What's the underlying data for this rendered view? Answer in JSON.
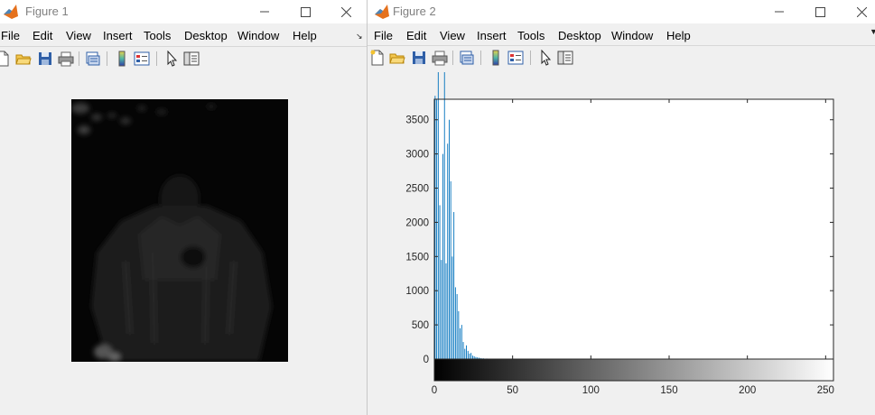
{
  "figure1": {
    "title": "Figure 1",
    "menu": [
      "File",
      "Edit",
      "View",
      "Insert",
      "Tools",
      "Desktop",
      "Window",
      "Help"
    ],
    "image": {
      "description_icon": "grayscale-dark-photo"
    }
  },
  "figure2": {
    "title": "Figure 2",
    "menu": [
      "File",
      "Edit",
      "View",
      "Insert",
      "Tools",
      "Desktop",
      "Window",
      "Help"
    ]
  },
  "window_controls": [
    "minimize-icon",
    "maximize-icon",
    "close-icon"
  ],
  "toolbar_icons": [
    "new-figure-icon",
    "open-file-icon",
    "save-icon",
    "print-icon",
    "print-preview-icon",
    "insert-colorbar-icon",
    "insert-legend-icon",
    "select-arrow-icon",
    "property-inspector-icon"
  ],
  "colors": {
    "bar": "#0072bd",
    "axis": "#262626",
    "matlab_orange": "#e5711d"
  },
  "chart_data": {
    "type": "bar",
    "title": "",
    "xlabel": "",
    "ylabel": "",
    "xlim": [
      0,
      255
    ],
    "ylim": [
      0,
      3800
    ],
    "x_ticks": [
      0,
      50,
      100,
      150,
      200,
      250
    ],
    "y_ticks": [
      0,
      500,
      1000,
      1500,
      2000,
      2500,
      3000,
      3500
    ],
    "colorbar": "grayscale 0-255",
    "series": [
      {
        "x": [
          0,
          1,
          2,
          3,
          4,
          5,
          6,
          7,
          8,
          9,
          10,
          11,
          12,
          13,
          14,
          15,
          16,
          17,
          18,
          19,
          20,
          21,
          22,
          23,
          24,
          25,
          26,
          27,
          28,
          29,
          30,
          31,
          33,
          35,
          38,
          42,
          46
        ],
        "values": [
          3850,
          3800,
          4200,
          2250,
          1450,
          3000,
          4200,
          1400,
          3150,
          3500,
          2600,
          1500,
          2150,
          1050,
          950,
          700,
          450,
          500,
          250,
          150,
          200,
          120,
          80,
          90,
          50,
          40,
          30,
          25,
          20,
          15,
          10,
          10,
          8,
          6,
          5,
          3,
          2
        ]
      }
    ]
  }
}
